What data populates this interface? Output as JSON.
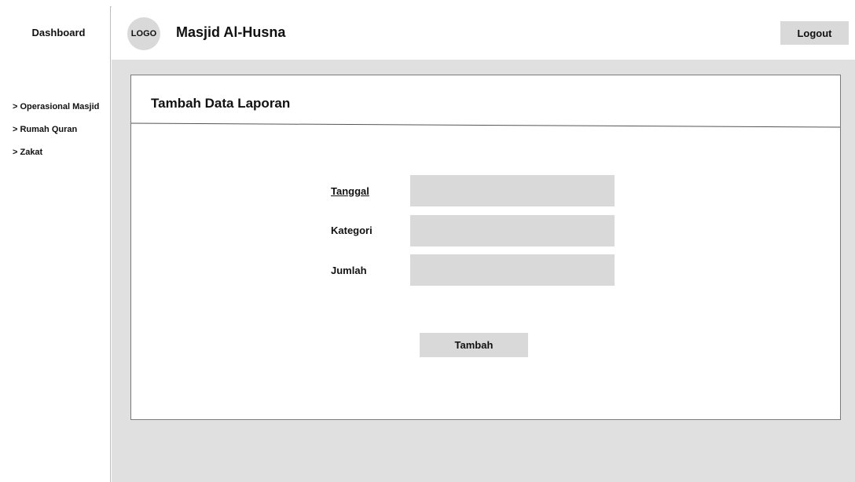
{
  "sidebar": {
    "title": "Dashboard",
    "items": [
      {
        "label": "> Operasional Masjid"
      },
      {
        "label": "> Rumah Quran"
      },
      {
        "label": "> Zakat"
      }
    ]
  },
  "header": {
    "logo_text": "LOGO",
    "app_title": "Masjid Al-Husna",
    "logout_label": "Logout"
  },
  "card": {
    "title": "Tambah Data Laporan"
  },
  "form": {
    "fields": [
      {
        "label": "Tanggal",
        "value": "",
        "placeholder": ""
      },
      {
        "label": "Kategori",
        "value": "",
        "placeholder": ""
      },
      {
        "label": "Jumlah",
        "value": "",
        "placeholder": ""
      }
    ],
    "submit_label": "Tambah"
  },
  "colors": {
    "placeholder_gray": "#d9d9d9",
    "canvas_gray": "#e0e0e0",
    "border_dark": "#7a7a7a"
  }
}
